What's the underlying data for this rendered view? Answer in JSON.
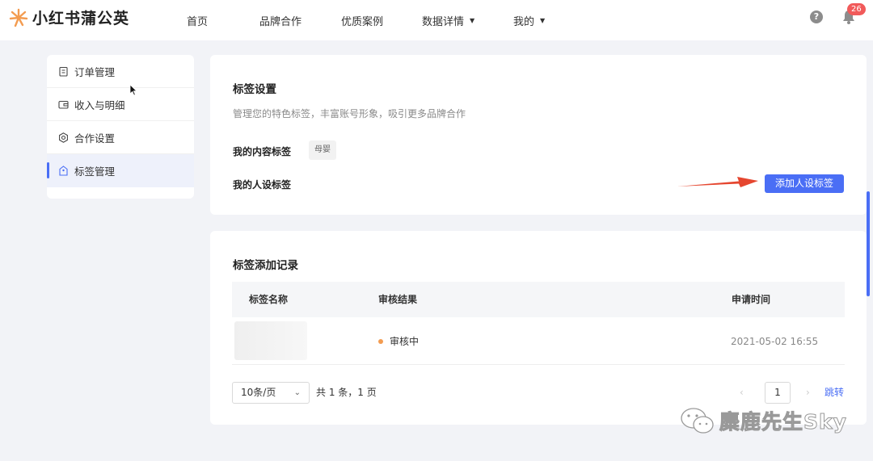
{
  "brand": {
    "name": "小红书蒲公英",
    "logo_icon": "dandelion-icon",
    "accent": "#f39c51"
  },
  "nav": [
    {
      "label": "首页",
      "has_caret": false
    },
    {
      "label": "品牌合作",
      "has_caret": false
    },
    {
      "label": "优质案例",
      "has_caret": false
    },
    {
      "label": "数据详情",
      "has_caret": true
    },
    {
      "label": "我的",
      "has_caret": true
    }
  ],
  "header": {
    "help_icon": "question-icon",
    "help_glyph": "?",
    "bell_icon": "bell-icon",
    "notification_count": "26"
  },
  "sidebar": {
    "items": [
      {
        "label": "订单管理",
        "icon": "clipboard-icon",
        "active": false
      },
      {
        "label": "收入与明细",
        "icon": "wallet-icon",
        "active": false
      },
      {
        "label": "合作设置",
        "icon": "gear-icon",
        "active": false
      },
      {
        "label": "标签管理",
        "icon": "tag-icon",
        "active": true
      }
    ]
  },
  "tag_settings": {
    "title": "标签设置",
    "description": "管理您的特色标签，丰富账号形象，吸引更多品牌合作",
    "content_tags_label": "我的内容标签",
    "content_tags": [
      "母婴"
    ],
    "persona_tags_label": "我的人设标签",
    "add_button_label": "添加人设标签"
  },
  "records": {
    "title": "标签添加记录",
    "columns": [
      "标签名称",
      "审核结果",
      "申请时间"
    ],
    "rows": [
      {
        "name": "",
        "status": "审核中",
        "status_color": "#f39c51",
        "time": "2021-05-02 16:55"
      }
    ],
    "pagination": {
      "page_size": "10条/页",
      "total_text": "共 1 条，1 页",
      "prev_glyph": "‹",
      "next_glyph": "›",
      "current_page": "1",
      "jump_label": "跳转"
    }
  },
  "watermark": {
    "text": "麋鹿先生Sky",
    "icon": "wechat-icon"
  },
  "colors": {
    "primary": "#4a6ef5",
    "badge": "#f15a5a",
    "arrow": "#e5462f"
  }
}
